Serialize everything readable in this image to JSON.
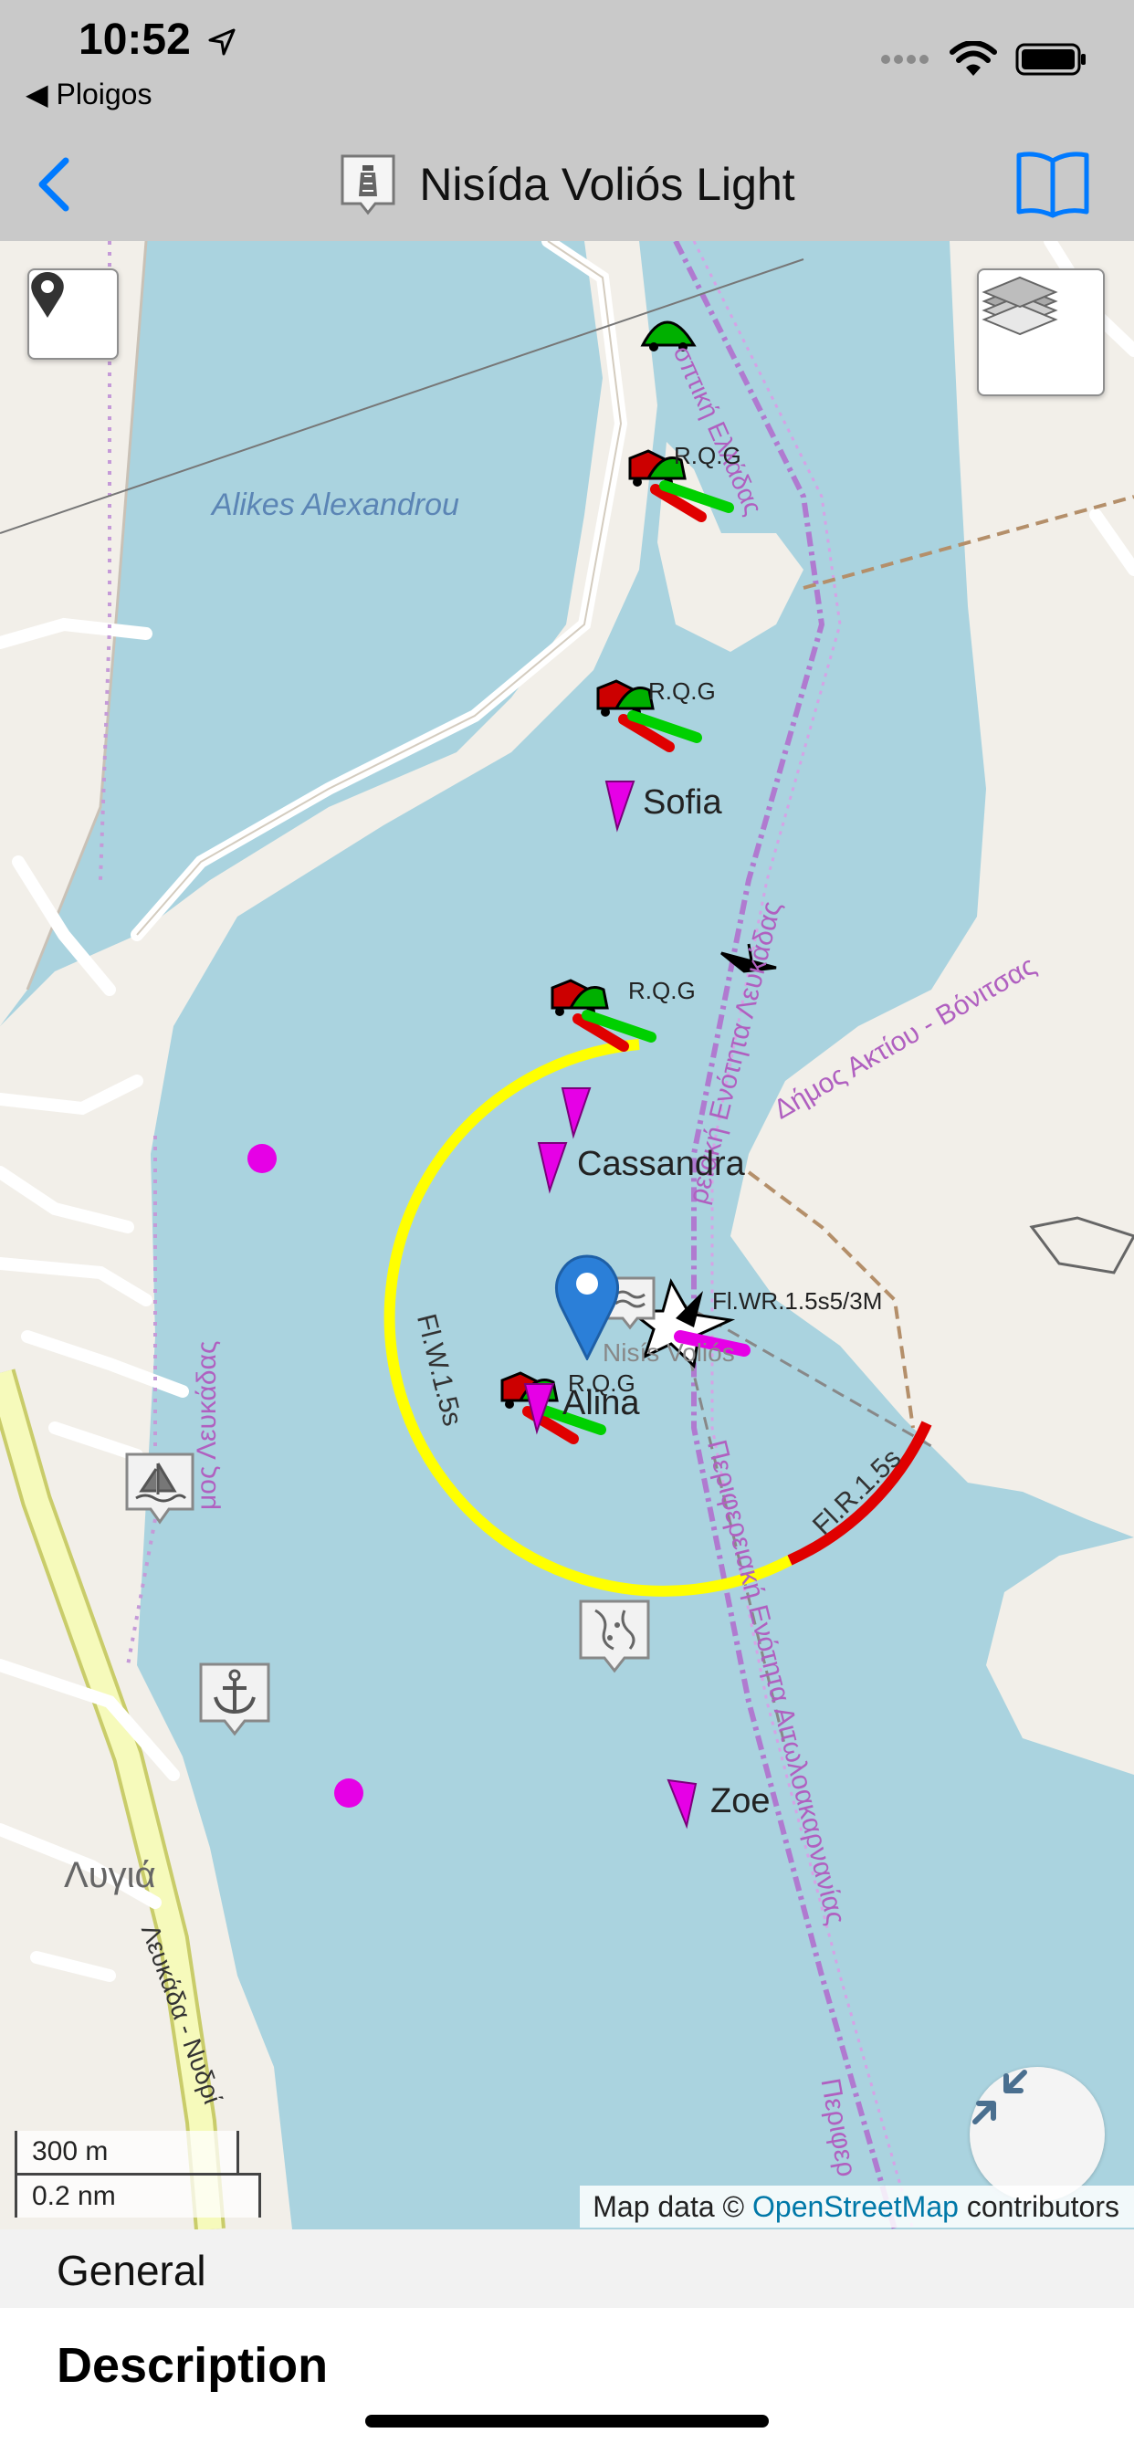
{
  "status_bar": {
    "time": "10:52",
    "back_app": "◀ Ploigos"
  },
  "nav": {
    "title": "Nisída Voliós Light",
    "back_icon": "chevron-left-icon",
    "title_icon": "lighthouse-icon",
    "book_icon": "book-icon"
  },
  "map": {
    "place_labels": {
      "alikes": "Alikes Alexandrou",
      "lygia": "Λυγιά"
    },
    "road_labels": {
      "north": "σπτική Ελλάδας",
      "aktiou": "Δήμος Ακτίου - Βόνιτσας",
      "lefkadas_left": "μος Λευκάδας",
      "lefkadas_center": "ρειακή Ενότητα Λευκάδας",
      "aitoloakarnanias": "Περιφερειακή Ενότητα Αιτωλοακαρνανίας",
      "perifereia": "Περιφερ",
      "nisida_road": "Λευκάδα - Νυδρί"
    },
    "light_labels": {
      "light1": "R.Q.G",
      "light2": "R.Q.G",
      "light3": "R.Q.G",
      "light4": "R.Q.G",
      "main_char": "Fl.WR.1.5s5/3M",
      "main_name": "Nisís Voliós",
      "sector_white": "Fl.W.1.5s",
      "sector_red": "Fl.R.1.5s"
    },
    "vessel_labels": {
      "sofia": "Sofia",
      "cassandra": "Cassandra",
      "alina": "Alina",
      "zoe": "Zoe"
    },
    "scale": {
      "metric": "300 m",
      "nautical": "0.2 nm"
    },
    "attribution": {
      "prefix": "Map data © ",
      "link": "OpenStreetMap",
      "suffix": " contributors"
    },
    "buttons": {
      "locate_icon": "location-pin-icon",
      "layers_icon": "layers-icon",
      "fullscreen_icon": "collapse-arrows-icon"
    }
  },
  "sections": {
    "general": "General",
    "description": "Description"
  },
  "colors": {
    "water": "#aad3df",
    "land": "#f2efe9",
    "sector_white": "#ffff00",
    "sector_red": "#e00000",
    "vessel": "#e600e6",
    "ios_blue": "#007aff",
    "marker_blue": "#2b7fd8"
  }
}
